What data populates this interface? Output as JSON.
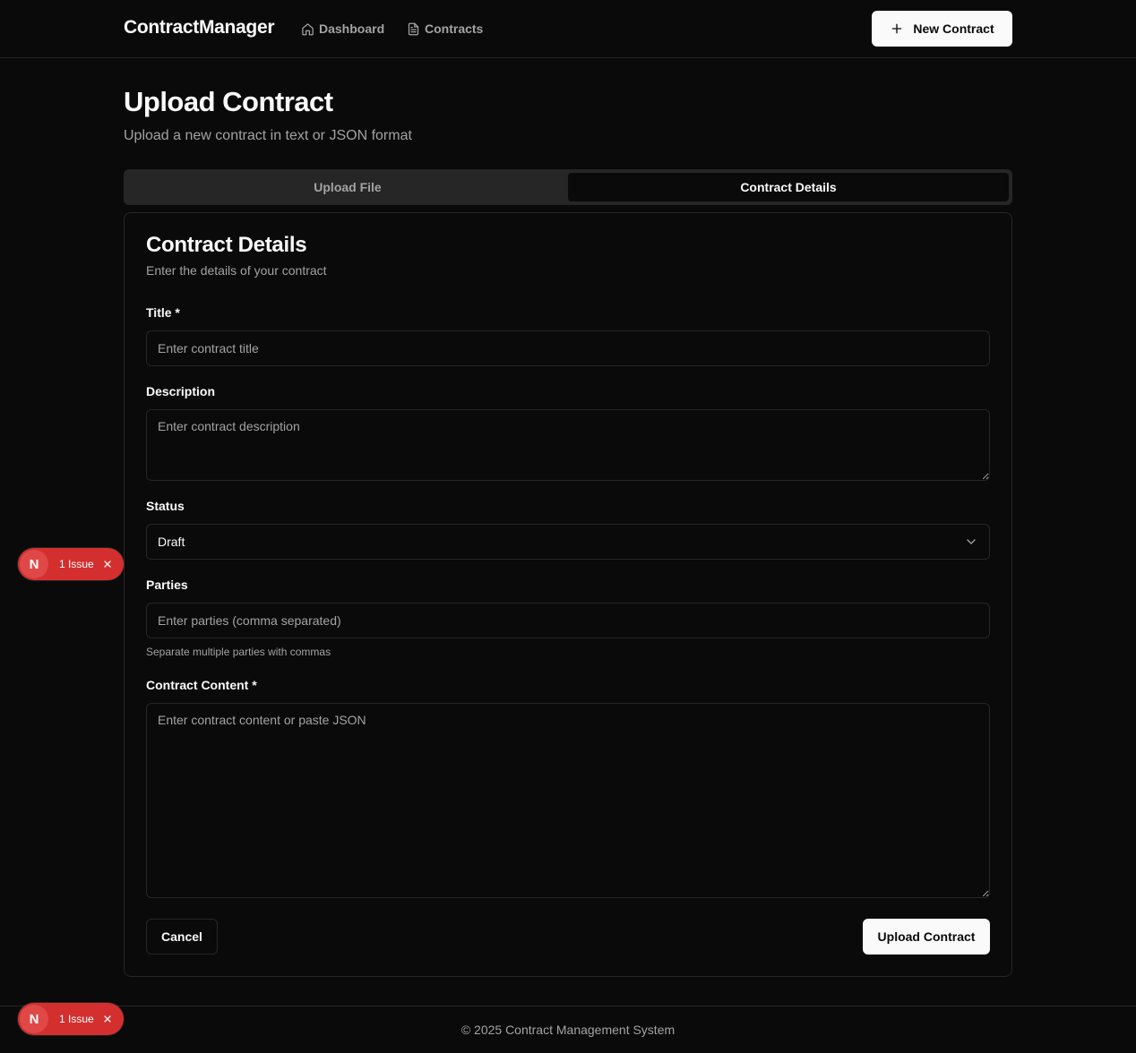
{
  "header": {
    "brand": "ContractManager",
    "nav": [
      {
        "label": "Dashboard",
        "icon": "home-icon"
      },
      {
        "label": "Contracts",
        "icon": "file-text-icon"
      }
    ],
    "new_contract_label": "New Contract"
  },
  "page": {
    "title": "Upload Contract",
    "subtitle": "Upload a new contract in text or JSON format"
  },
  "tabs": [
    {
      "label": "Upload File",
      "active": false
    },
    {
      "label": "Contract Details",
      "active": true
    }
  ],
  "form": {
    "title": "Contract Details",
    "subtitle": "Enter the details of your contract",
    "title_label": "Title *",
    "title_placeholder": "Enter contract title",
    "description_label": "Description",
    "description_placeholder": "Enter contract description",
    "status_label": "Status",
    "status_value": "Draft",
    "parties_label": "Parties",
    "parties_placeholder": "Enter parties (comma separated)",
    "parties_hint": "Separate multiple parties with commas",
    "content_label": "Contract Content *",
    "content_placeholder": "Enter contract content or paste JSON",
    "cancel_label": "Cancel",
    "submit_label": "Upload Contract"
  },
  "footer": {
    "text": "© 2025 Contract Management System"
  },
  "dev_indicator": {
    "logo_letter": "N",
    "label": "1 Issue",
    "color": "#d32f2f"
  },
  "colors": {
    "background": "#0a0a0a",
    "border": "#262626",
    "muted_text": "#a3a3a3",
    "primary": "#fafafa"
  }
}
